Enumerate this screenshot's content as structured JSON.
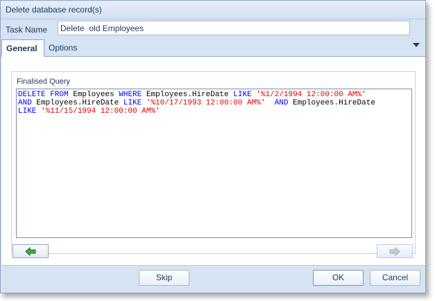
{
  "window": {
    "title": "Delete database record(s)"
  },
  "task": {
    "label": "Task Name",
    "value": "Delete  old Employees"
  },
  "tabs": [
    {
      "label": "General",
      "active": true
    },
    {
      "label": "Options",
      "active": false
    }
  ],
  "group": {
    "label": "Finalised Query"
  },
  "query": {
    "lines": [
      [
        {
          "t": "DELETE FROM",
          "k": "kw"
        },
        {
          "t": " Employees ",
          "k": "txt"
        },
        {
          "t": "WHERE",
          "k": "kw"
        },
        {
          "t": " Employees.HireDate ",
          "k": "txt"
        },
        {
          "t": "LIKE",
          "k": "kw"
        },
        {
          "t": " ",
          "k": "txt"
        },
        {
          "t": "'%1/2/1994 12:00:00 AM%'",
          "k": "str"
        }
      ],
      [
        {
          "t": "AND",
          "k": "kw"
        },
        {
          "t": " Employees.HireDate ",
          "k": "txt"
        },
        {
          "t": "LIKE",
          "k": "kw"
        },
        {
          "t": " ",
          "k": "txt"
        },
        {
          "t": "'%10/17/1993 12:00:00 AM%'",
          "k": "str"
        },
        {
          "t": "  ",
          "k": "txt"
        },
        {
          "t": "AND",
          "k": "kw"
        },
        {
          "t": " Employees.HireDate",
          "k": "txt"
        }
      ],
      [
        {
          "t": "LIKE",
          "k": "kw"
        },
        {
          "t": " ",
          "k": "txt"
        },
        {
          "t": "'%11/15/1994 12:00:00 AM%'",
          "k": "str"
        }
      ]
    ]
  },
  "nav": {
    "back_icon": "arrow-left-icon",
    "forward_icon": "arrow-right-icon"
  },
  "buttons": {
    "skip": "Skip",
    "ok": "OK",
    "cancel": "Cancel"
  },
  "colors": {
    "keyword": "#0000ff",
    "string": "#e00000",
    "frame": "#d6e3f3",
    "back_arrow": "#2e9e2e"
  }
}
